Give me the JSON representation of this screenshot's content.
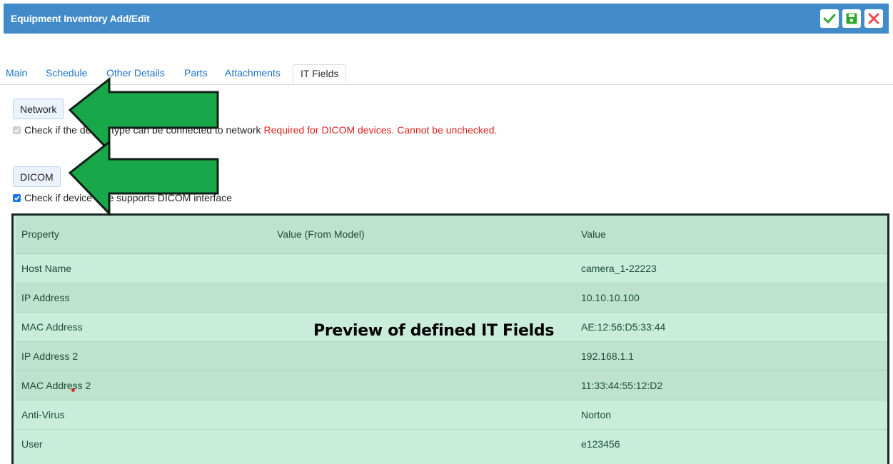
{
  "header": {
    "title": "Equipment Inventory Add/Edit",
    "actions": {
      "confirm": "check-icon",
      "save": "save-icon",
      "close": "close-icon"
    },
    "color": "#428bca"
  },
  "tabs": [
    {
      "label": "Main"
    },
    {
      "label": "Schedule"
    },
    {
      "label": "Other Details"
    },
    {
      "label": "Parts"
    },
    {
      "label": "Attachments"
    },
    {
      "label": "IT Fields",
      "active": true
    }
  ],
  "network": {
    "button_label": "Network",
    "checkbox_label": "Check if the device type can be connected to network",
    "checked": true,
    "disabled": true,
    "required_note": "Required for DICOM devices. Cannot be unchecked."
  },
  "dicom": {
    "button_label": "DICOM",
    "checkbox_label": "Check if device type supports DICOM interface",
    "checked": true
  },
  "it_table": {
    "headers": [
      "Property",
      "Value (From Model)",
      "Value"
    ],
    "rows": [
      {
        "property": "Host Name",
        "model_value": "",
        "value": "camera_1-22223"
      },
      {
        "property": "IP Address",
        "model_value": "",
        "value": "10.10.10.100"
      },
      {
        "property": "MAC Address",
        "model_value": "",
        "value": "AE:12:56:D5:33:44"
      },
      {
        "property": "IP Address 2",
        "model_value": "",
        "value": "192.168.1.1"
      },
      {
        "property": "MAC Address 2",
        "model_value": "",
        "value": "11:33:44:55:12:D2"
      },
      {
        "property": "Anti-Virus",
        "model_value": "",
        "value": "Norton"
      },
      {
        "property": "User",
        "model_value": "",
        "value": "e123456"
      }
    ]
  },
  "annotation": {
    "caption": "Preview of defined IT Fields",
    "arrow_color": "#17a34a"
  }
}
